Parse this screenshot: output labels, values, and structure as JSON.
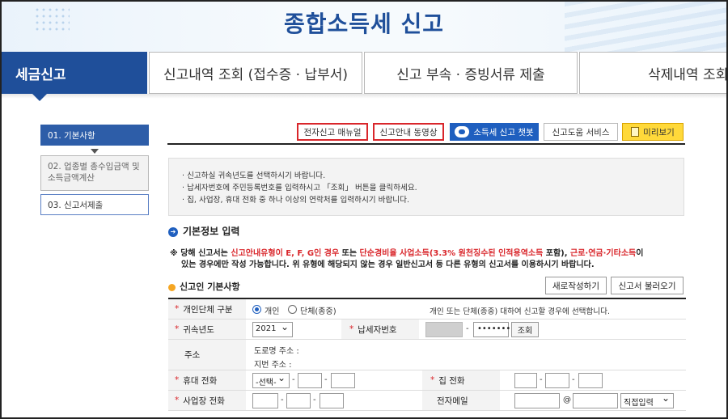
{
  "header": {
    "title": "종합소득세 신고"
  },
  "tabs": [
    {
      "label": "세금신고",
      "active": true
    },
    {
      "label": "신고내역 조회 (접수증 · 납부서)"
    },
    {
      "label": "신고 부속 · 증빙서류 제출"
    },
    {
      "label": "삭제내역 조회"
    }
  ],
  "steps": [
    {
      "label": "01. 기본사항",
      "state": "active"
    },
    {
      "label": "02. 업종별 총수입금액 및 소득금액계산",
      "state": "pending"
    },
    {
      "label": "03. 신고서제출",
      "state": "normal"
    }
  ],
  "toolbar": {
    "manual": "전자신고 매뉴얼",
    "video": "신고안내 동영상",
    "chatbot": "소득세 신고 챗봇",
    "help": "신고도움 서비스",
    "preview": "미리보기"
  },
  "notice": [
    "· 신고하실 귀속년도를 선택하시기 바랍니다.",
    "· 납세자번호에 주민등록번호를 입력하시고 「조회」 버튼을 클릭하세요.",
    "· 집, 사업장, 휴대 전화 중 하나 이상의 연락처를 입력하시기 바랍니다."
  ],
  "section": {
    "title": "기본정보 입력"
  },
  "warning": {
    "prefix": "※ 당해 신고서는 ",
    "red1": "신고안내유형이 E, F, G인 경우",
    "mid1": " 또는 ",
    "red2": "단순경비율 사업소득(3.3% 원천징수된 인적용역소득",
    "mid2": " 포함), ",
    "red3": "근로·연금·기타소득",
    "mid3": "이",
    "line2": "있는 경우에만 작성 가능합니다. 위 유형에 해당되지 않는 경우 일반신고서 등 다른 유형의 신고서를 이용하시기 바랍니다."
  },
  "reporter": {
    "title": "신고인 기본사항",
    "new_button": "새로작성하기",
    "load_button": "신고서 불러오기"
  },
  "form": {
    "type_label": "개인단체 구분",
    "type_individual": "개인",
    "type_group": "단체(종중)",
    "type_hint": "개인 또는 단체(종중) 대하여 신고할 경우에 선택합니다.",
    "year_label": "귀속년도",
    "year_value": "2021",
    "taxpayer_label": "납세자번호",
    "taxpayer_dash": "-",
    "taxpayer_masked": "•••••••",
    "lookup_button": "조회",
    "address_label": "주소",
    "road_address": "도로명 주소 :",
    "lot_address": "지번 주소 :",
    "mobile_label": "휴대 전화",
    "mobile_select": "-선택-",
    "home_label": "집 전화",
    "office_label": "사업장 전화",
    "email_label": "전자메일",
    "email_at": "@",
    "email_select": "직접입력",
    "dash": "-"
  }
}
